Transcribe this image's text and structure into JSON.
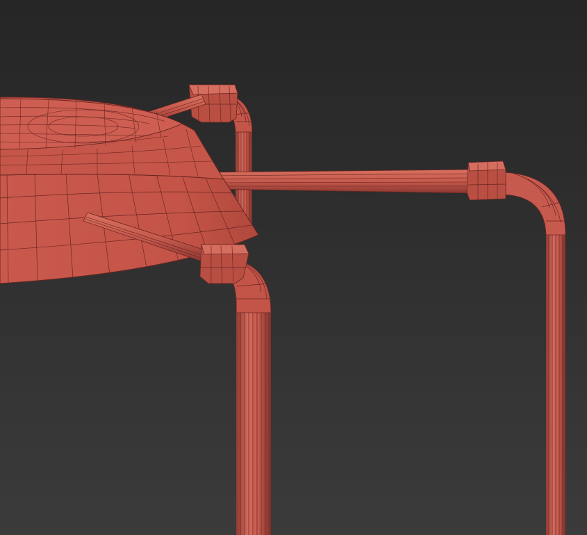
{
  "viewport": {
    "background_top": "#262626",
    "background_bottom": "#3b3b3b"
  },
  "model": {
    "material_color": "#c75a4e",
    "wire_color": "#6a2622",
    "shade_dark": "#9c433b",
    "highlight": "#dc7a6c"
  }
}
